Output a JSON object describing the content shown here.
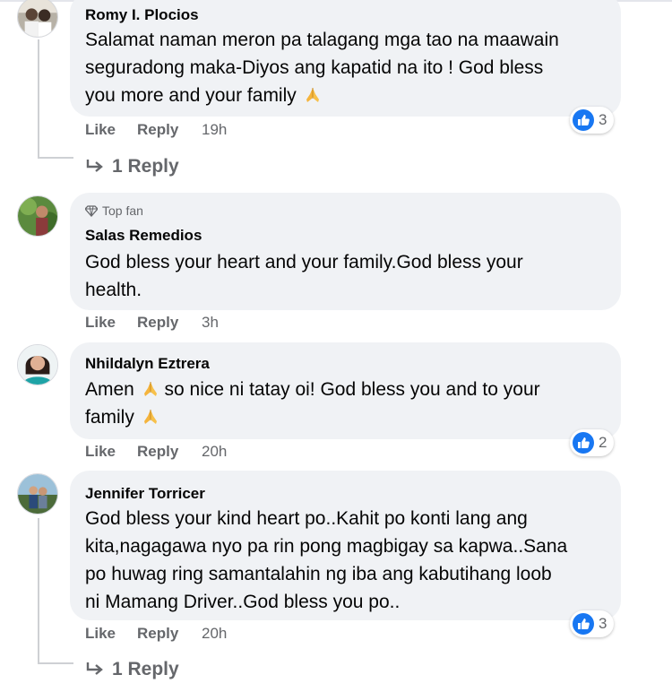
{
  "comments": [
    {
      "author": "Romy I. Plocios",
      "badge": "",
      "lines": [
        "Salamat naman meron pa talagang mga tao na maawain",
        "seguradong maka-Diyos ang kapatid na ito ! God bless",
        "you more and your family"
      ],
      "like_label": "Like",
      "reply_label": "Reply",
      "time": "19h",
      "reaction_count": "3",
      "replies_label": "1 Reply"
    },
    {
      "author": "Salas Remedios",
      "badge": "Top fan",
      "lines": [
        "God bless your heart and your family.God bless your",
        "health."
      ],
      "like_label": "Like",
      "reply_label": "Reply",
      "time": "3h"
    },
    {
      "author": "Nhildalyn Eztrera",
      "badge": "",
      "lines": [
        "Amen",
        "so nice ni tatay oi! God bless you and to your",
        "family"
      ],
      "like_label": "Like",
      "reply_label": "Reply",
      "time": "20h",
      "reaction_count": "2"
    },
    {
      "author": "Jennifer Torricer",
      "badge": "",
      "lines": [
        "God bless your kind heart po..Kahit po konti lang ang",
        "kita,nagagawa nyo pa rin pong magbigay sa kapwa..Sana",
        "po huwag ring samantalahin ng iba ang kabutihang loob",
        "ni Mamang Driver..God bless you po.."
      ],
      "like_label": "Like",
      "reply_label": "Reply",
      "time": "20h",
      "reaction_count": "3",
      "replies_label": "1 Reply"
    }
  ],
  "icons": {
    "reaction": "like-reaction-icon",
    "pray": "folded-hands-emoji",
    "reply_arrow": "reply-arrow-icon",
    "badge": "diamond-icon"
  },
  "colors": {
    "bubble": "#f0f2f5",
    "secondary_text": "#65676b",
    "like_blue": "#1877f2"
  }
}
